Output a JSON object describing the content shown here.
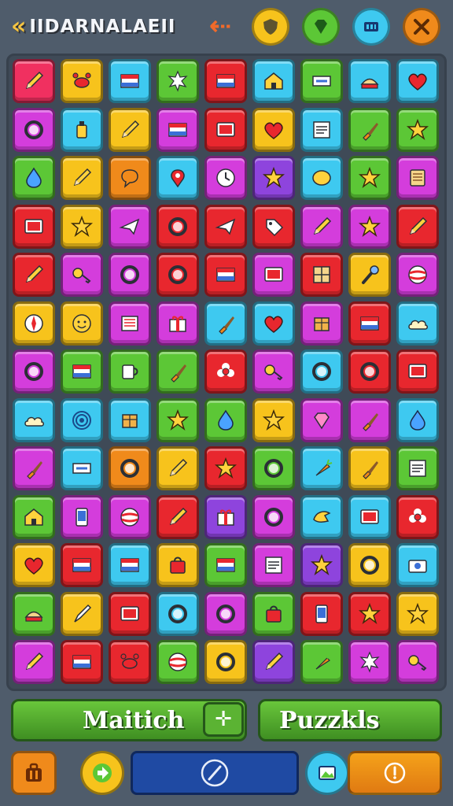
{
  "header": {
    "logo_text": "IIDARNALAEII",
    "logo_arrow": "«",
    "buttons": [
      {
        "name": "shield-button",
        "icon": "shield-icon"
      },
      {
        "name": "gem-button",
        "icon": "gem-icon"
      },
      {
        "name": "menu-button",
        "icon": "grid-icon"
      },
      {
        "name": "tools-button",
        "icon": "tools-icon"
      }
    ]
  },
  "board": {
    "rows": 13,
    "cols": 9,
    "tiles": [
      [
        "#f03060",
        "#f7c31c",
        "#3ec9f0",
        "#5cc736",
        "#e8272e",
        "#3ec9f0",
        "#5cc736",
        "#3ec9f0",
        "#3ec9f0"
      ],
      [
        "#d43ddc",
        "#3ec9f0",
        "#f7c31c",
        "#d43ddc",
        "#e8272e",
        "#f7c31c",
        "#3ec9f0",
        "#5cc736",
        "#5cc736"
      ],
      [
        "#5cc736",
        "#f7c31c",
        "#f08a1b",
        "#3ec9f0",
        "#d43ddc",
        "#8e44dd",
        "#3ec9f0",
        "#5cc736",
        "#d43ddc"
      ],
      [
        "#e8272e",
        "#f7c31c",
        "#d43ddc",
        "#e8272e",
        "#e8272e",
        "#e8272e",
        "#d43ddc",
        "#d43ddc",
        "#e8272e"
      ],
      [
        "#e8272e",
        "#d43ddc",
        "#d43ddc",
        "#e8272e",
        "#e8272e",
        "#d43ddc",
        "#e8272e",
        "#f7c31c",
        "#d43ddc"
      ],
      [
        "#f7c31c",
        "#f7c31c",
        "#d43ddc",
        "#d43ddc",
        "#3ec9f0",
        "#3ec9f0",
        "#d43ddc",
        "#e8272e",
        "#3ec9f0"
      ],
      [
        "#d43ddc",
        "#5cc736",
        "#5cc736",
        "#5cc736",
        "#e8272e",
        "#d43ddc",
        "#3ec9f0",
        "#e8272e",
        "#e8272e"
      ],
      [
        "#3ec9f0",
        "#3ec9f0",
        "#3ec9f0",
        "#5cc736",
        "#5cc736",
        "#f7c31c",
        "#d43ddc",
        "#d43ddc",
        "#3ec9f0"
      ],
      [
        "#d43ddc",
        "#3ec9f0",
        "#f08a1b",
        "#f7c31c",
        "#e8272e",
        "#5cc736",
        "#3ec9f0",
        "#f7c31c",
        "#5cc736"
      ],
      [
        "#5cc736",
        "#d43ddc",
        "#d43ddc",
        "#e8272e",
        "#8e44dd",
        "#d43ddc",
        "#3ec9f0",
        "#3ec9f0",
        "#e8272e"
      ],
      [
        "#f7c31c",
        "#e8272e",
        "#3ec9f0",
        "#f7c31c",
        "#5cc736",
        "#d43ddc",
        "#8e44dd",
        "#f7c31c",
        "#3ec9f0"
      ],
      [
        "#5cc736",
        "#f7c31c",
        "#e8272e",
        "#3ec9f0",
        "#d43ddc",
        "#5cc736",
        "#e8272e",
        "#e8272e",
        "#f7c31c"
      ],
      [
        "#d43ddc",
        "#e8272e",
        "#e8272e",
        "#5cc736",
        "#f7c31c",
        "#8e44dd",
        "#5cc736",
        "#d43ddc",
        "#d43ddc"
      ]
    ],
    "icons": [
      [
        "pencil-icon",
        "crab-icon",
        "flag-icon",
        "splash-icon",
        "flag-icon",
        "house-icon",
        "sign-icon",
        "cake-icon",
        "heart-icon"
      ],
      [
        "ring-icon",
        "bottle-icon",
        "pencil-icon",
        "flag-icon",
        "tv-icon",
        "heart-icon",
        "note-icon",
        "brush-icon",
        "star-icon"
      ],
      [
        "drop-icon",
        "pencil-icon",
        "bubble-icon",
        "pin-icon",
        "clock-icon",
        "star-icon",
        "lemon-icon",
        "star-icon",
        "scroll-icon"
      ],
      [
        "tv-icon",
        "star-icon",
        "plane-icon",
        "ring-icon",
        "plane-icon",
        "tag-icon",
        "pencil-icon",
        "star-icon",
        "pencil-icon"
      ],
      [
        "pencil-icon",
        "key-icon",
        "ring-icon",
        "ring-icon",
        "flag-icon",
        "tv-icon",
        "grid-icon",
        "wrench-icon",
        "ball-icon"
      ],
      [
        "compass-icon",
        "face-icon",
        "list-icon",
        "gift-icon",
        "brush-icon",
        "heart-icon",
        "box-icon",
        "flag-icon",
        "cloud-icon"
      ],
      [
        "ring-icon",
        "flag-icon",
        "mug-icon",
        "brush-icon",
        "flower-icon",
        "key-icon",
        "ring-icon",
        "ring-icon",
        "tv-icon"
      ],
      [
        "cloud-icon",
        "swirl-icon",
        "box-icon",
        "star-icon",
        "drop-icon",
        "star-icon",
        "diamond-icon",
        "brush-icon",
        "drop-icon"
      ],
      [
        "brush-icon",
        "sign-icon",
        "ring-icon",
        "pencil-icon",
        "star-icon",
        "ring-icon",
        "carrot-icon",
        "brush-icon",
        "note-icon"
      ],
      [
        "house-icon",
        "phone-icon",
        "ball-icon",
        "pencil-icon",
        "gift-icon",
        "ring-icon",
        "bird-icon",
        "tv-icon",
        "flower-icon"
      ],
      [
        "heart-icon",
        "flag-icon",
        "flag-icon",
        "bag-icon",
        "flag-icon",
        "note-icon",
        "star-icon",
        "ring-icon",
        "camera-icon"
      ],
      [
        "cake-icon",
        "pen-icon",
        "tv-icon",
        "ring-icon",
        "ring-icon",
        "bag-icon",
        "phone-icon",
        "star-icon",
        "star-icon"
      ],
      [
        "pencil-icon",
        "flag-icon",
        "crab-icon",
        "ball-icon",
        "ring-icon",
        "pencil-icon",
        "carrot-icon",
        "splash-icon",
        "key-icon"
      ]
    ]
  },
  "actions": {
    "match_label": "Maitich",
    "puzzle_label": "Puzzkls"
  },
  "toolbar": {
    "items": [
      "bag-icon",
      "next-icon",
      "slash-icon",
      "image-icon",
      "timer-icon"
    ]
  }
}
